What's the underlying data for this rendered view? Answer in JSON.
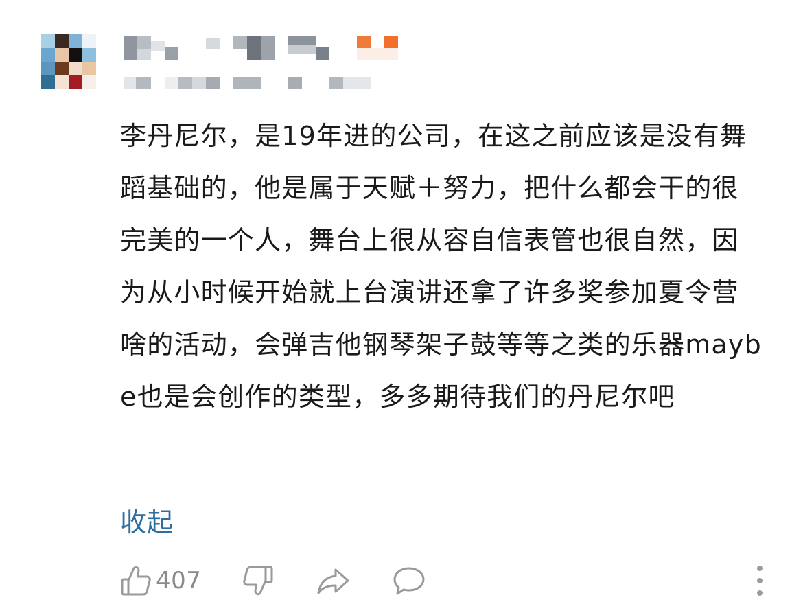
{
  "comment": {
    "text": "李丹尼尔，是19年进的公司，在这之前应该是没有舞蹈基础的，他是属于天赋＋努力，把什么都会干的很完美的一个人，舞台上很从容自信表管也很自然，因为从小时候开始就上台演讲还拿了许多奖参加夏令营啥的活动，会弹吉他钢琴架子鼓等等之类的乐器maybe也是会创作的类型，多多期待我们的丹尼尔吧",
    "collapse_label": "收起"
  },
  "actions": {
    "like_count": "407",
    "like_icon": "thumbs-up-icon",
    "dislike_icon": "thumbs-down-icon",
    "share_icon": "share-icon",
    "reply_icon": "comment-bubble-icon",
    "more_icon": "more-vertical-icon"
  },
  "colors": {
    "link": "#2e6e9e",
    "icon_gray": "#9a9a9a",
    "text": "#1a1a1a"
  }
}
